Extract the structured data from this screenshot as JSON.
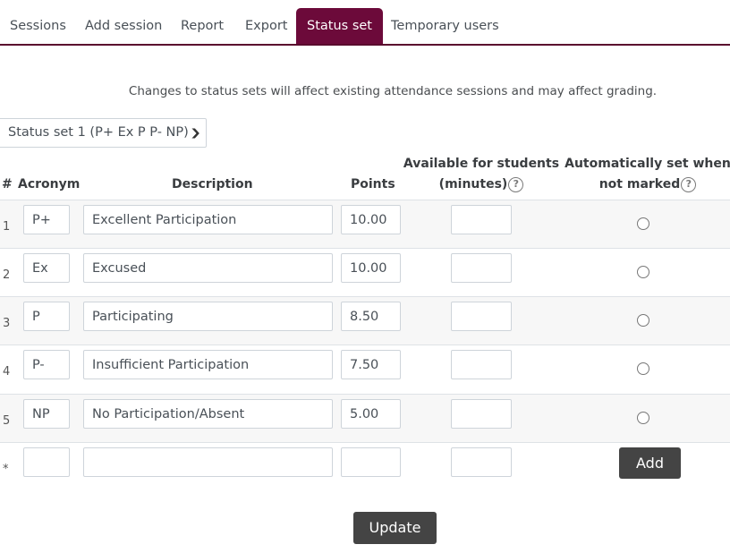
{
  "tabs": [
    {
      "label": "Sessions",
      "active": false
    },
    {
      "label": "Add session",
      "active": false
    },
    {
      "label": "Report",
      "active": false
    },
    {
      "label": "Export",
      "active": false
    },
    {
      "label": "Status set",
      "active": true
    },
    {
      "label": "Temporary users",
      "active": false
    }
  ],
  "notice": "Changes to status sets will affect existing attendance sessions and may affect grading.",
  "status_set_select": {
    "selected": "Status set 1 (P+ Ex P P- NP)"
  },
  "table": {
    "headers": {
      "num": "#",
      "acronym": "Acronym",
      "description": "Description",
      "points": "Points",
      "available_line1": "Available for students",
      "available_line2": "(minutes)",
      "auto_line1": "Automatically set when",
      "auto_line2": "not marked"
    },
    "help_icon": "?",
    "rows": [
      {
        "num": "1",
        "acronym": "P+",
        "description": "Excellent Participation",
        "points": "10.00",
        "minutes": "",
        "auto_set": false
      },
      {
        "num": "2",
        "acronym": "Ex",
        "description": "Excused",
        "points": "10.00",
        "minutes": "",
        "auto_set": false
      },
      {
        "num": "3",
        "acronym": "P",
        "description": "Participating",
        "points": "8.50",
        "minutes": "",
        "auto_set": false
      },
      {
        "num": "4",
        "acronym": "P-",
        "description": "Insufficient Participation",
        "points": "7.50",
        "minutes": "",
        "auto_set": false
      },
      {
        "num": "5",
        "acronym": "NP",
        "description": "No Participation/Absent",
        "points": "5.00",
        "minutes": "",
        "auto_set": false
      }
    ],
    "new_row": {
      "num": "*",
      "acronym": "",
      "description": "",
      "points": "",
      "minutes": ""
    }
  },
  "buttons": {
    "add": "Add",
    "update": "Update"
  },
  "colors": {
    "accent": "#6c0a3a",
    "button": "#444444"
  }
}
